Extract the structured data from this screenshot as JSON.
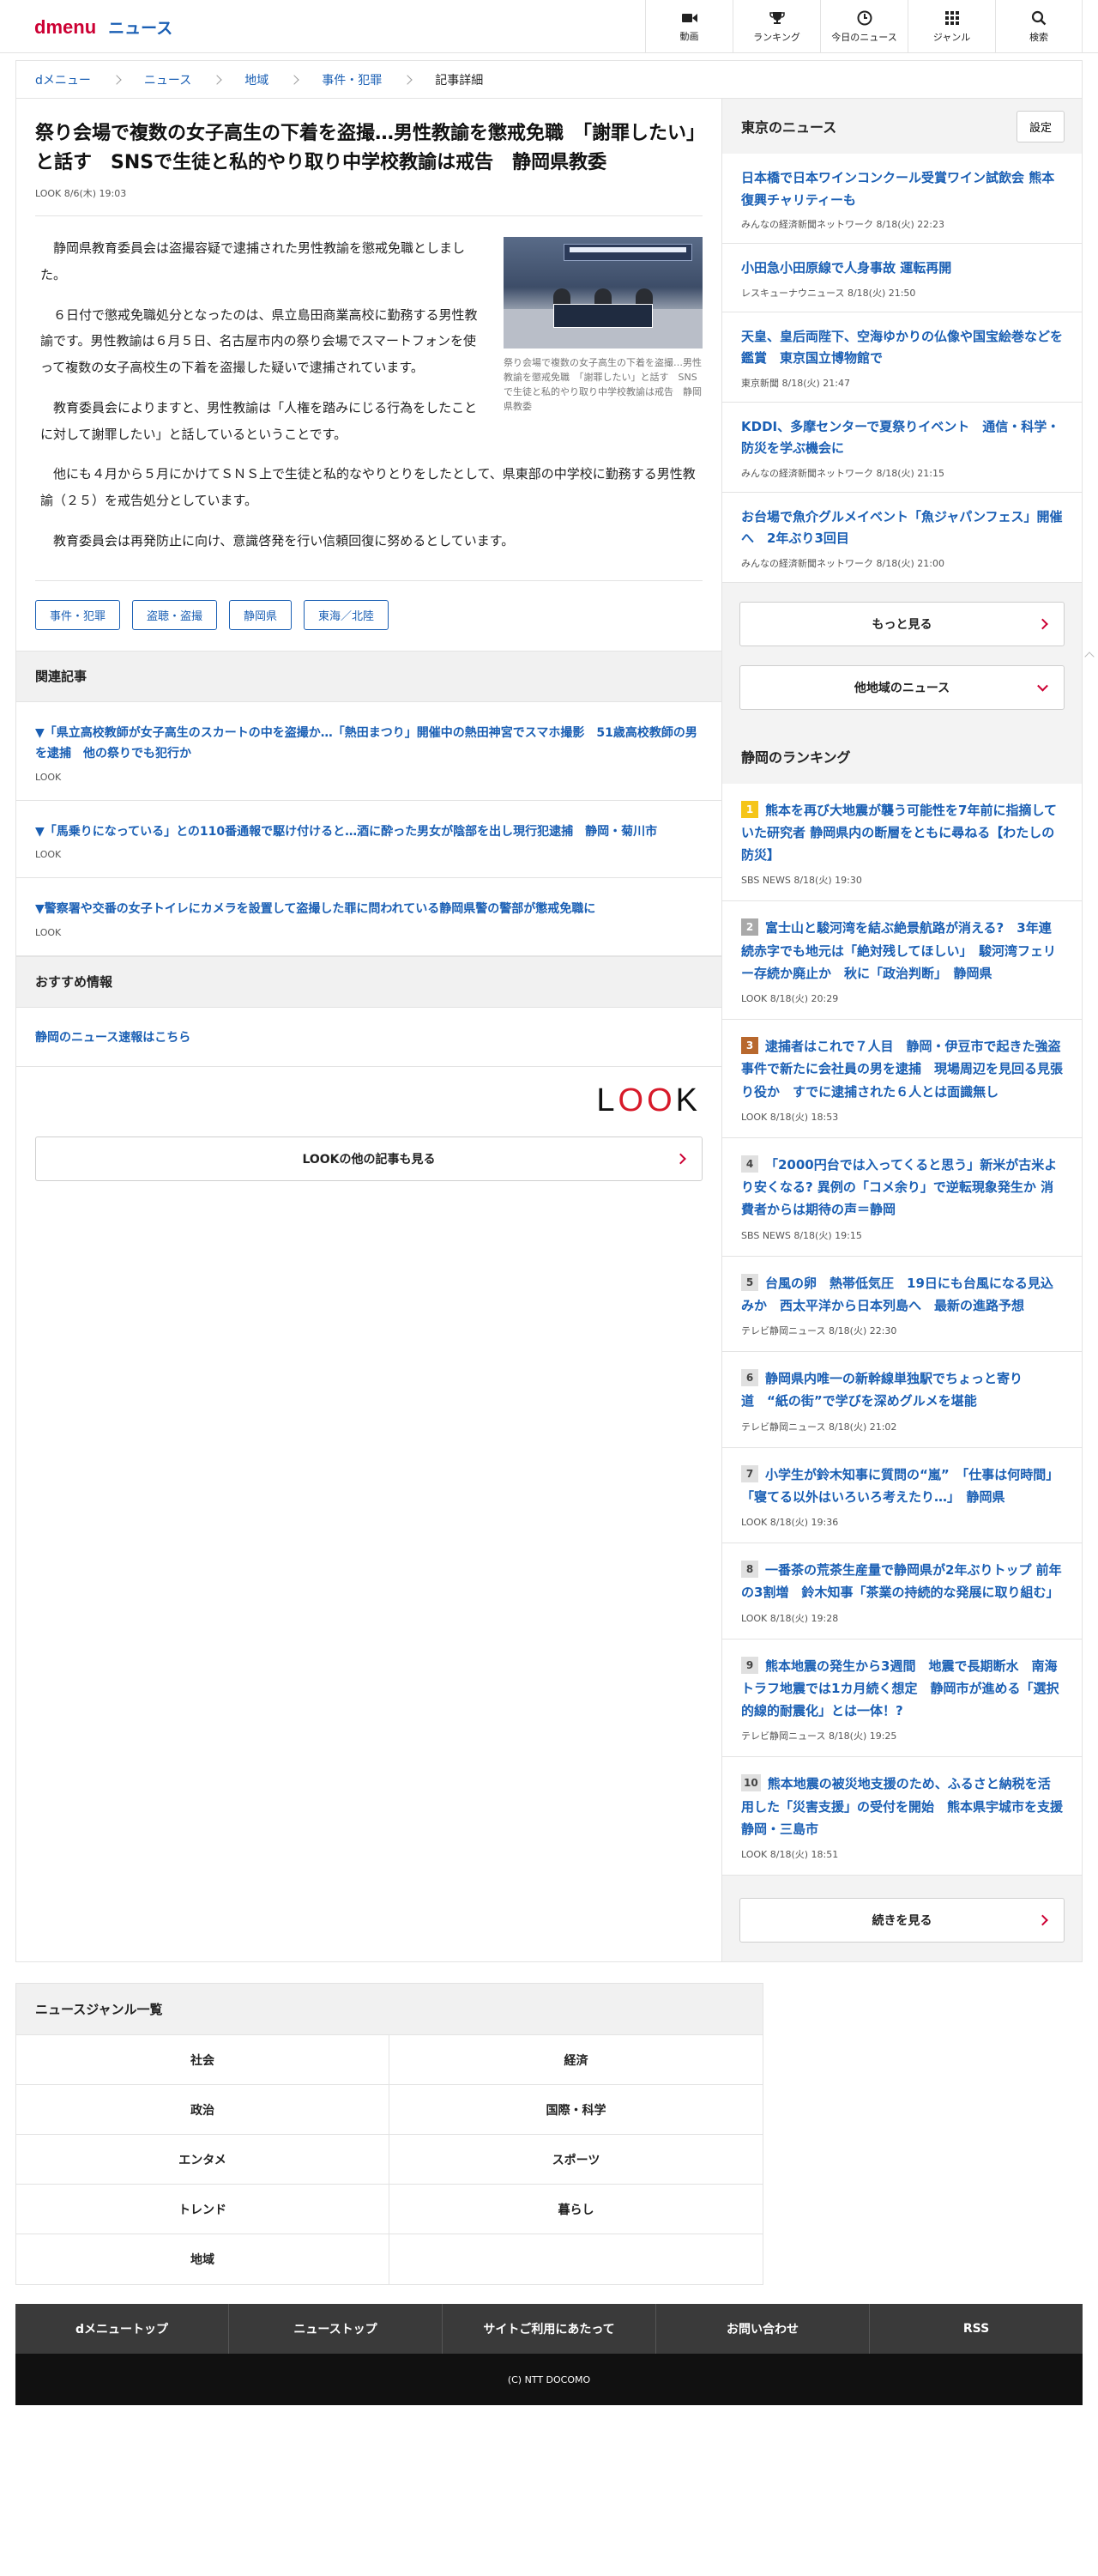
{
  "header": {
    "logo_d": "d",
    "logo_menu": "menu",
    "logo_news": "ニュース",
    "nav": [
      {
        "label": "動画",
        "icon": "video-icon"
      },
      {
        "label": "ランキング",
        "icon": "trophy-icon"
      },
      {
        "label": "今日のニュース",
        "icon": "clock-icon"
      },
      {
        "label": "ジャンル",
        "icon": "grid-icon"
      },
      {
        "label": "検索",
        "icon": "search-icon"
      }
    ]
  },
  "breadcrumb": [
    "dメニュー",
    "ニュース",
    "地域",
    "事件・犯罪",
    "記事詳細"
  ],
  "article": {
    "title": "祭り会場で複数の女子高生の下着を盗撮…男性教諭を懲戒免職　「謝罪したい」と話す　SNSで生徒と私的やり取り中学校教諭は戒告　静岡県教委",
    "meta": "LOOK 8/6(木) 19:03",
    "photo_caption": "祭り会場で複数の女子高生の下着を盗撮…男性教諭を懲戒免職　「謝罪したい」と話す　SNSで生徒と私的やり取り中学校教諭は戒告　静岡県教委",
    "paragraphs": [
      "静岡県教育委員会は盗撮容疑で逮捕された男性教諭を懲戒免職としました。",
      "６日付で懲戒免職処分となったのは、県立島田商業高校に勤務する男性教諭です。男性教諭は６月５日、名古屋市内の祭り会場でスマートフォンを使って複数の女子高校生の下着を盗撮した疑いで逮捕されています。",
      "教育委員会によりますと、男性教諭は「人権を踏みにじる行為をしたことに対して謝罪したい」と話しているということです。",
      "他にも４月から５月にかけてＳＮＳ上で生徒と私的なやりとりをしたとして、県東部の中学校に勤務する男性教諭（２５）を戒告処分としています。",
      "教育委員会は再発防止に向け、意識啓発を行い信頼回復に努めるとしています。"
    ],
    "tags": [
      "事件・犯罪",
      "盗聴・盗撮",
      "静岡県",
      "東海／北陸"
    ]
  },
  "related": {
    "heading": "関連記事",
    "items": [
      {
        "title": "▼「県立高校教師が女子高生のスカートの中を盗撮か…「熱田まつり」開催中の熱田神宮でスマホ撮影　51歳高校教師の男を逮捕　他の祭りでも犯行か",
        "src": "LOOK"
      },
      {
        "title": "▼「馬乗りになっている」との110番通報で駆け付けると…酒に酔った男女が陰部を出し現行犯逮捕　静岡・菊川市",
        "src": "LOOK"
      },
      {
        "title": "▼警察署や交番の女子トイレにカメラを設置して盗撮した罪に問われている静岡県警の警部が懲戒免職に",
        "src": "LOOK"
      }
    ]
  },
  "recommend": {
    "heading": "おすすめ情報",
    "link": "静岡のニュース速報はこちら"
  },
  "look": {
    "logo": [
      "L",
      "O",
      "O",
      "K"
    ],
    "more_label": "LOOKの他の記事も見る"
  },
  "sidebar": {
    "heading": "東京のニュース",
    "setting_label": "設定",
    "items": [
      {
        "title": "日本橋で日本ワインコンクール受賞ワイン試飲会 熊本復興チャリティーも",
        "meta": "みんなの経済新聞ネットワーク 8/18(火) 22:23"
      },
      {
        "title": "小田急小田原線で人身事故 運転再開",
        "meta": "レスキューナウニュース 8/18(火) 21:50"
      },
      {
        "title": "天皇、皇后両陛下、空海ゆかりの仏像や国宝絵巻などを鑑賞　東京国立博物館で",
        "meta": "東京新聞 8/18(火) 21:47"
      },
      {
        "title": "KDDI、多摩センターで夏祭りイベント　通信・科学・防災を学ぶ機会に",
        "meta": "みんなの経済新聞ネットワーク 8/18(火) 21:15"
      },
      {
        "title": "お台場で魚介グルメイベント「魚ジャパンフェス」開催へ　2年ぶり3回目",
        "meta": "みんなの経済新聞ネットワーク 8/18(火) 21:00"
      }
    ],
    "more_label": "もっと見る",
    "other_region_label": "他地域のニュース"
  },
  "ranking": {
    "heading": "静岡のランキング",
    "items": [
      {
        "num": "1",
        "title": "熊本を再び大地震が襲う可能性を7年前に指摘していた研究者 静岡県内の断層をともに尋ねる【わたしの防災】",
        "meta": "SBS NEWS 8/18(火) 19:30"
      },
      {
        "num": "2",
        "title": "富士山と駿河湾を結ぶ絶景航路が消える?　3年連続赤字でも地元は「絶対残してほしい」　駿河湾フェリー存続か廃止か　秋に「政治判断」　静岡県",
        "meta": "LOOK 8/18(火) 20:29"
      },
      {
        "num": "3",
        "title": "逮捕者はこれで７人目　静岡・伊豆市で起きた強盗事件で新たに会社員の男を逮捕　現場周辺を見回る見張り役か　すでに逮捕された６人とは面識無し",
        "meta": "LOOK 8/18(火) 18:53"
      },
      {
        "num": "4",
        "title": "「2000円台では入ってくると思う」新米が古米より安くなる? 異例の「コメ余り」で逆転現象発生か 消費者からは期待の声＝静岡",
        "meta": "SBS NEWS 8/18(火) 19:15"
      },
      {
        "num": "5",
        "title": "台風の卵　熱帯低気圧　19日にも台風になる見込みか　西太平洋から日本列島へ　最新の進路予想",
        "meta": "テレビ静岡ニュース 8/18(火) 22:30"
      },
      {
        "num": "6",
        "title": "静岡県内唯一の新幹線単独駅でちょっと寄り道　“紙の街”で学びを深めグルメを堪能",
        "meta": "テレビ静岡ニュース 8/18(火) 21:02"
      },
      {
        "num": "7",
        "title": "小学生が鈴木知事に質問の“嵐”　「仕事は何時間」「寝てる以外はいろいろ考えたり…」　静岡県",
        "meta": "LOOK 8/18(火) 19:36"
      },
      {
        "num": "8",
        "title": "一番茶の荒茶生産量で静岡県が2年ぶりトップ 前年の3割増　鈴木知事「茶業の持続的な発展に取り組む」",
        "meta": "LOOK 8/18(火) 19:28"
      },
      {
        "num": "9",
        "title": "熊本地震の発生から3週間　地震で長期断水　南海トラフ地震では1カ月続く想定　静岡市が進める「選択的線的耐震化」とは一体！?",
        "meta": "テレビ静岡ニュース 8/18(火) 19:25"
      },
      {
        "num": "10",
        "title": "熊本地震の被災地支援のため、ふるさと納税を活用した「災害支援」の受付を開始　熊本県宇城市を支援　静岡・三島市",
        "meta": "LOOK 8/18(火) 18:51"
      }
    ],
    "more_label": "続きを見る"
  },
  "genres": {
    "heading": "ニュースジャンル一覧",
    "items": [
      "社会",
      "経済",
      "政治",
      "国際・科学",
      "エンタメ",
      "スポーツ",
      "トレンド",
      "暮らし",
      "地域",
      ""
    ]
  },
  "footer": {
    "links": [
      "dメニュートップ",
      "ニューストップ",
      "サイトご利用にあたって",
      "お問い合わせ",
      "RSS"
    ],
    "copyright": "(C) NTT DOCOMO"
  },
  "colors": {
    "brand": "#cc0033",
    "link": "#1a5fb4",
    "rank1": "#f5c518",
    "rank2": "#a9a9a9",
    "rank3": "#b8682d"
  }
}
